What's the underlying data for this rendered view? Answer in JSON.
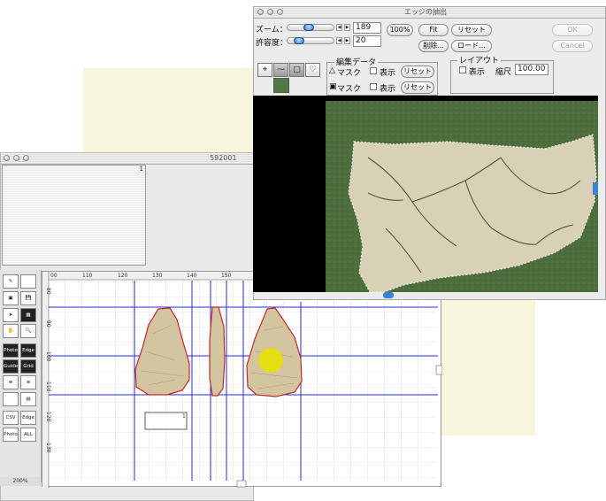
{
  "edge_window": {
    "title": "エッジの抽出",
    "zoom_label": "ズーム：",
    "zoom_value": "189",
    "tolerance_label": "許容度：",
    "tolerance_value": "20",
    "btn_100": "100%",
    "btn_fit": "Fit",
    "btn_reset": "リセット",
    "btn_delete": "削除...",
    "btn_load": "ロード...",
    "btn_ok": "OK",
    "btn_cancel": "Cancel",
    "edit_data": {
      "legend": "編集データ",
      "mask1_label": "マスク",
      "mask2_label": "マスク",
      "show_label": "表示",
      "reset_label": "リセット"
    },
    "layout": {
      "legend": "レイアウト",
      "show_label": "表示",
      "scale_label": "縮尺",
      "scale_value": "100.00"
    },
    "swatch_color": "#4f7a40"
  },
  "doc_window": {
    "title": "592001",
    "preview_number": "1",
    "zoom_level": "200%",
    "box_number": "1",
    "ruler_labels": [
      "00",
      "110",
      "120",
      "130",
      "140",
      "150"
    ],
    "vruler_labels": [
      "80",
      "90",
      "100",
      "110",
      "120",
      "130"
    ],
    "tools": {
      "photo": "Photo",
      "edge": "Edge",
      "guide": "Guide",
      "grid": "Grid",
      "csv": "CSV",
      "edge2": "Edge",
      "photo2": "Photo",
      "all": "ALL"
    }
  },
  "colors": {
    "guide_line": "#2b2bd0",
    "artifact_outline": "#c22a2a",
    "artifact_fill": "#d2c5a0",
    "highlight": "#e8e000",
    "stone_bg": "#4d6e3c",
    "cream": "#f7f5dc"
  }
}
